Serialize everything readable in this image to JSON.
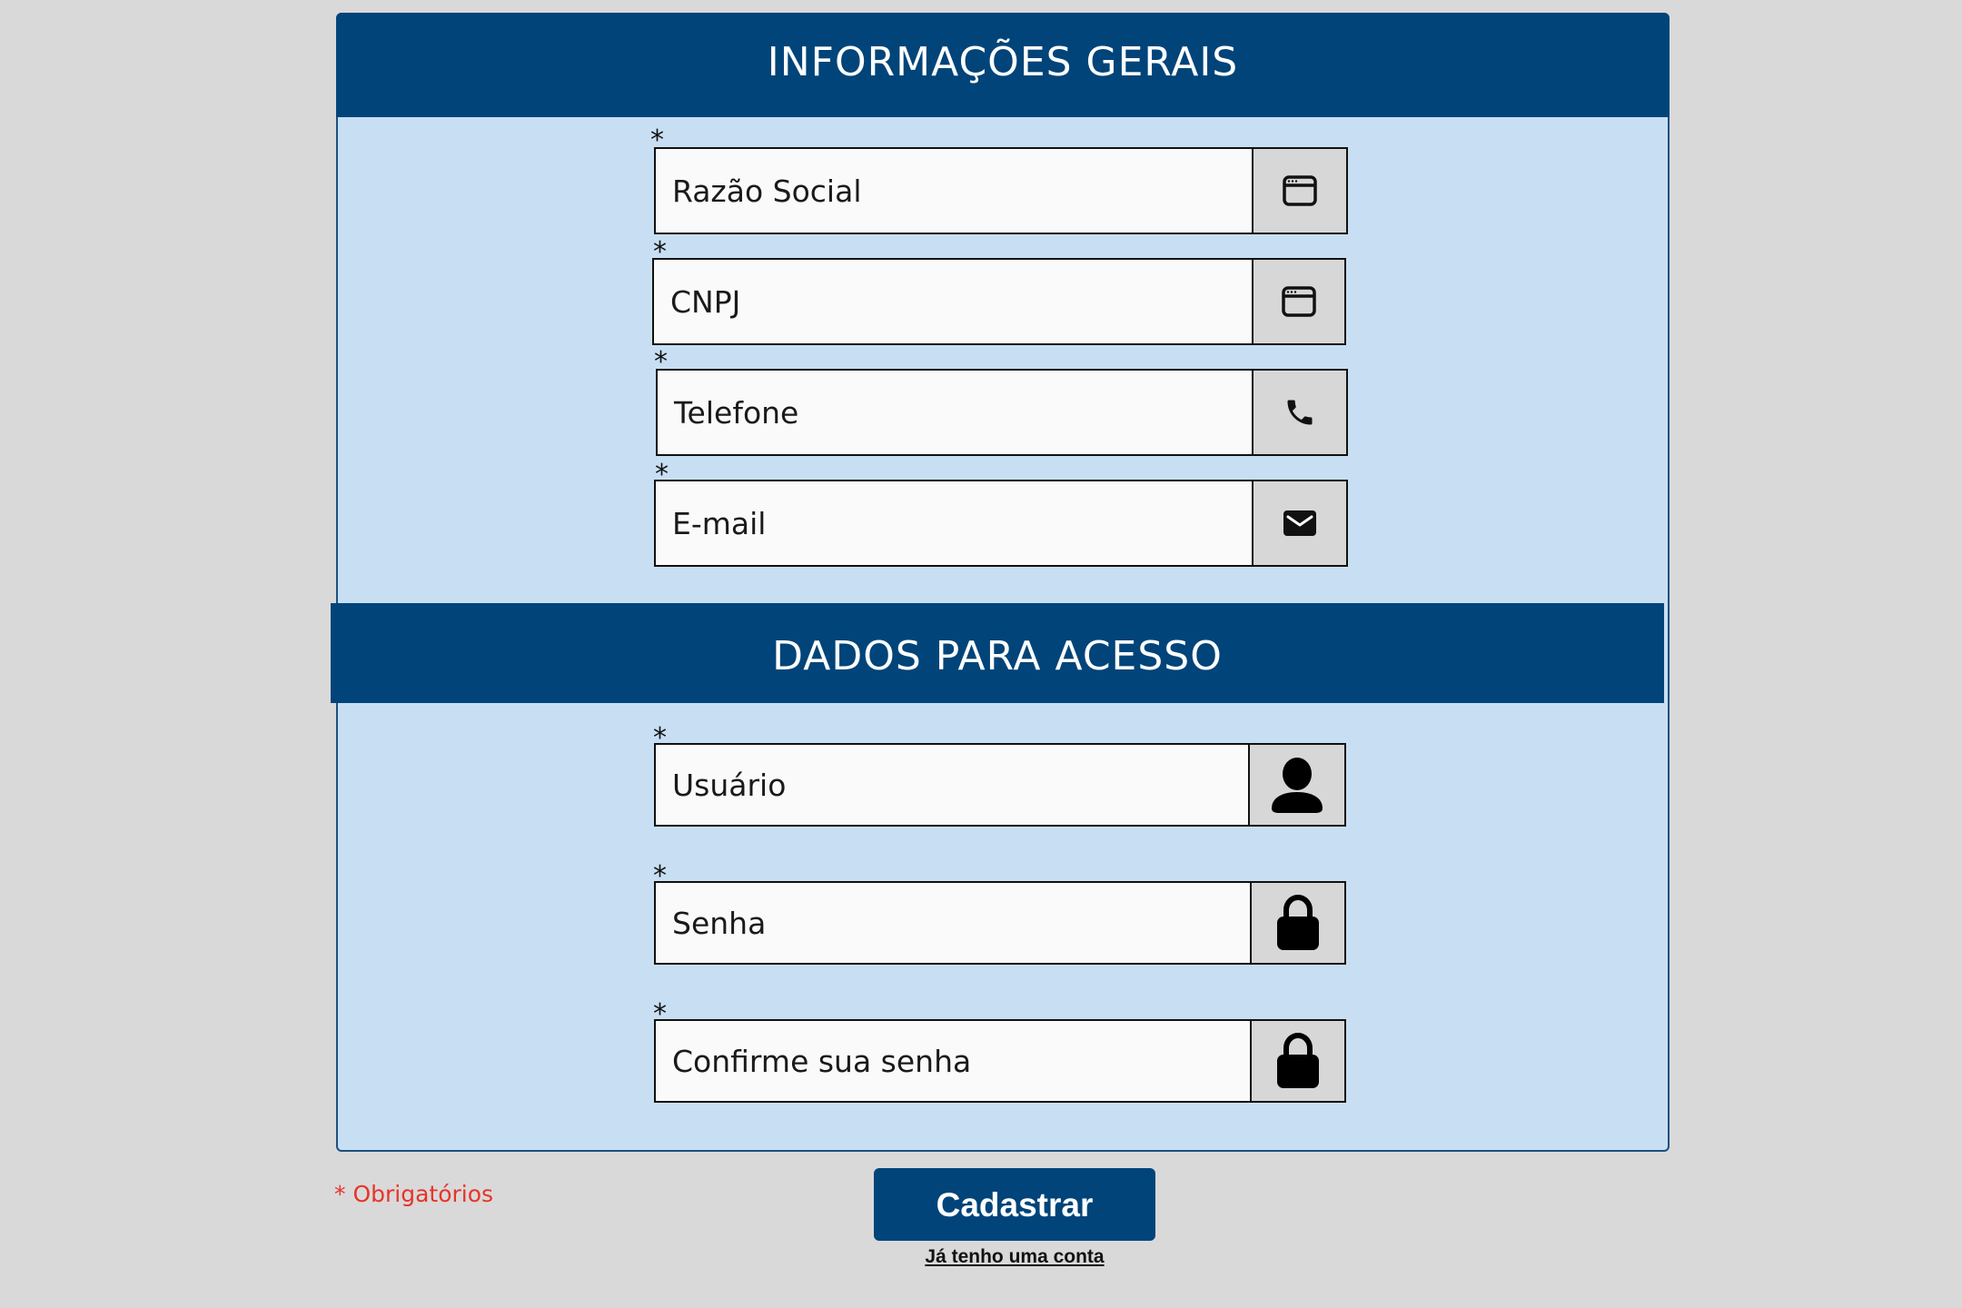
{
  "sections": {
    "general_info_title": "INFORMAÇÕES GERAIS",
    "access_data_title": "DADOS PARA ACESSO"
  },
  "required_mark": "*",
  "fields": {
    "razao_social": {
      "placeholder": "Razão Social",
      "value": "",
      "icon": "browser-window-icon"
    },
    "cnpj": {
      "placeholder": "CNPJ",
      "value": "",
      "icon": "browser-window-icon"
    },
    "telefone": {
      "placeholder": "Telefone",
      "value": "",
      "icon": "phone-icon"
    },
    "email": {
      "placeholder": "E-mail",
      "value": "",
      "icon": "envelope-icon"
    },
    "usuario": {
      "placeholder": "Usuário",
      "value": "",
      "icon": "user-icon"
    },
    "senha": {
      "placeholder": "Senha",
      "value": "",
      "icon": "lock-icon"
    },
    "confirmar_senha": {
      "placeholder": "Confirme sua senha",
      "value": "",
      "icon": "lock-icon"
    }
  },
  "required_note": "* Obrigatórios",
  "submit_label": "Cadastrar",
  "login_link_label": "Já tenho uma conta",
  "colors": {
    "background": "#d9d9d9",
    "panel": "#c8dff3",
    "header": "#004479",
    "icon_box": "#d7d7d7",
    "required_note": "#e8332a"
  }
}
